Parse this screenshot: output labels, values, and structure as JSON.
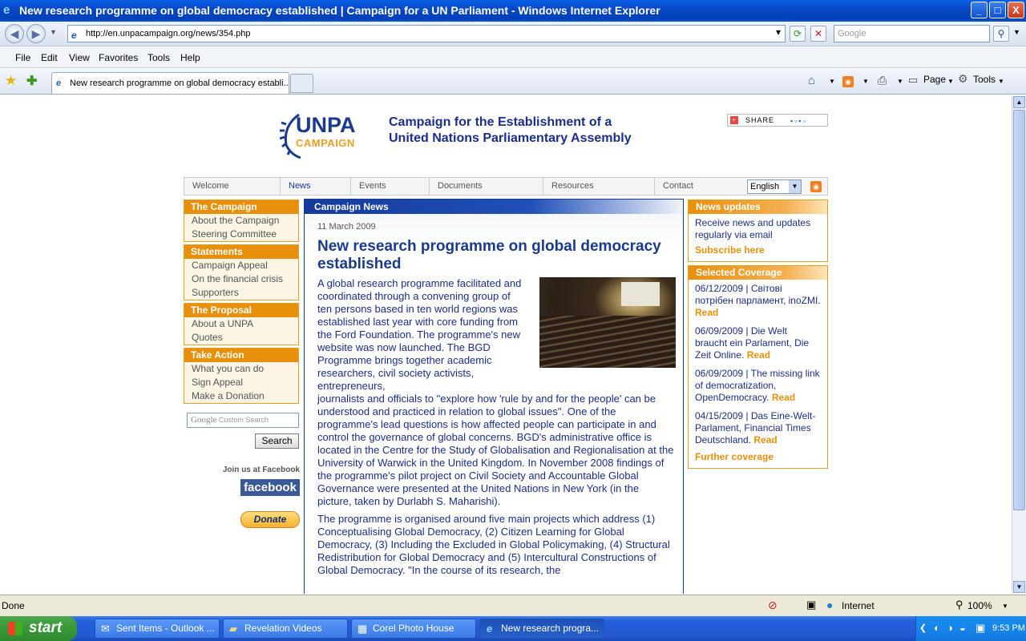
{
  "window": {
    "title": "New research programme on global democracy established | Campaign for a UN Parliament - Windows Internet Explorer",
    "buttons": {
      "minimize": "_",
      "maximize": "□",
      "close": "X"
    }
  },
  "address_bar": {
    "url": "http://en.unpacampaign.org/news/354.php",
    "search_placeholder": "Google"
  },
  "menu": [
    "File",
    "Edit",
    "View",
    "Favorites",
    "Tools",
    "Help"
  ],
  "tabs": {
    "active_label": "New research programme on global democracy establi...",
    "tools": {
      "page": "Page",
      "tools": "Tools"
    }
  },
  "site": {
    "logo_main": "UNPA",
    "logo_sub": "CAMPAIGN",
    "tagline_line1": "Campaign for the Establishment of a",
    "tagline_line2": "United Nations Parliamentary Assembly",
    "share": "SHARE",
    "nav": [
      "Welcome",
      "News",
      "Events",
      "Documents",
      "Resources",
      "Contact"
    ],
    "language": "English",
    "sidebar": [
      {
        "title": "The Campaign",
        "items": [
          "About the Campaign",
          "Steering Committee"
        ]
      },
      {
        "title": "Statements",
        "items": [
          "Campaign Appeal",
          "On the financial crisis",
          "Supporters"
        ]
      },
      {
        "title": "The Proposal",
        "items": [
          "About a UNPA",
          "Quotes"
        ]
      },
      {
        "title": "Take Action",
        "items": [
          "What you can do",
          "Sign Appeal",
          "Make a Donation"
        ]
      }
    ],
    "custom_search_placeholder": "Custom Search",
    "search_button": "Search",
    "join_facebook": "Join us at Facebook",
    "facebook": "facebook",
    "donate": "Donate",
    "main": {
      "header": "Campaign News",
      "date": "11 March 2009",
      "title": "New research programme on global democracy established",
      "para1_wrapped": "A global research programme facilitated and coordinated through a convening group of ten persons based in ten world regions was established last year with core funding from the Ford Foundation. The programme's new website was now launched. The BGD Programme brings together academic researchers, civil society activists, entrepreneurs,",
      "para1_full": "journalists and officials to \"explore how 'rule by and for the people' can be understood and practiced in relation to global issues\". One of the programme's lead questions is how affected people can participate in and control the governance of global concerns. BGD's administrative office is located in the Centre for the Study of Globalisation and Regionalisation at the University of Warwick in the United Kingdom. In November 2008 findings of the programme's pilot project on Civil Society and Accountable Global Governance were presented at the United Nations in New York (in the picture, taken by Durlabh S. Maharishi).",
      "para2": "The programme is organised around five main projects which address (1) Conceptualising Global Democracy, (2) Citizen Learning for Global Democracy, (3) Including the Excluded in Global Policymaking, (4) Structural Redistribution for Global Democracy and (5) Intercultural Constructions of Global Democracy. \"In the course of its research, the"
    },
    "news_updates": {
      "title": "News updates",
      "text": "Receive news and updates regularly via email",
      "link": "Subscribe here"
    },
    "coverage": {
      "title": "Selected Coverage",
      "items": [
        {
          "text": "06/12/2009 | Світові потрібен парламент, inoZMI.",
          "read": "Read"
        },
        {
          "text": "06/09/2009 | Die Welt braucht ein Parlament, Die Zeit Online.",
          "read": "Read"
        },
        {
          "text": "06/09/2009 | The missing link of democratization, OpenDemocracy.",
          "read": "Read"
        },
        {
          "text": "04/15/2009 | Das Eine-Welt-Parlament, Financial Times Deutschland.",
          "read": "Read"
        }
      ],
      "more": "Further coverage"
    }
  },
  "status": {
    "text": "Done",
    "zone": "Internet",
    "zoom": "100%"
  },
  "taskbar": {
    "start": "start",
    "tasks": [
      "Sent Items - Outlook ...",
      "Revelation Videos",
      "Corel Photo House",
      "New research progra..."
    ],
    "clock": "9:53 PM"
  }
}
